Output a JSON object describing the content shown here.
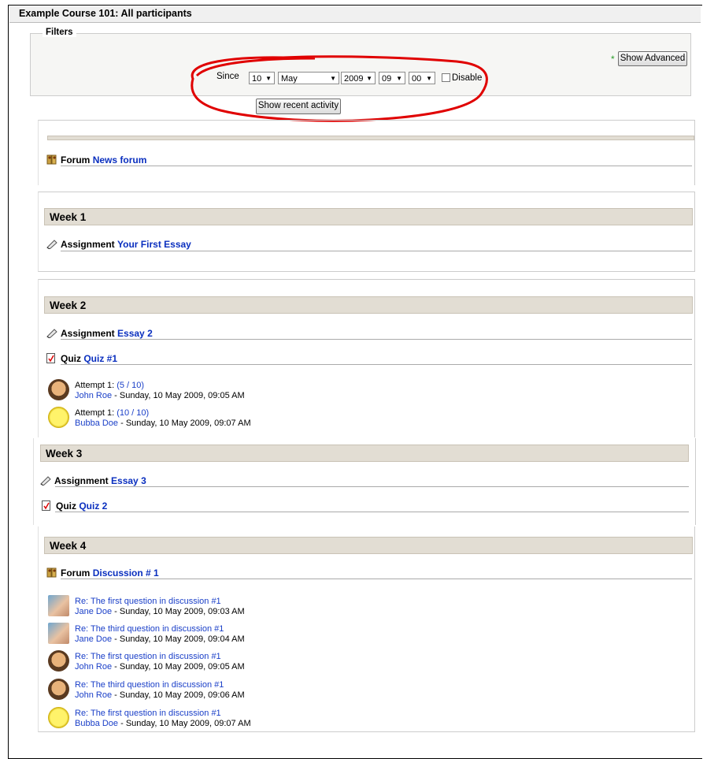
{
  "course": {
    "title": "Example Course 101: All participants"
  },
  "filters": {
    "legend": "Filters",
    "since_label": "Since",
    "day": "10",
    "month": "May",
    "year": "2009",
    "hour": "09",
    "minute": "00",
    "disable_label": "Disable",
    "required_mark": "*",
    "show_advanced": "Show Advanced",
    "show_recent": "Show recent activity"
  },
  "general": {
    "kind": "Forum",
    "name": "News forum"
  },
  "week1": {
    "title": "Week 1",
    "items": [
      {
        "kind": "Assignment",
        "name": "Your First Essay"
      }
    ]
  },
  "week2": {
    "title": "Week 2",
    "items": [
      {
        "kind": "Assignment",
        "name": "Essay 2"
      },
      {
        "kind": "Quiz",
        "name": "Quiz #1"
      }
    ],
    "attempts": [
      {
        "label": "Attempt 1:",
        "score": "(5 / 10)",
        "user": "John Roe",
        "when": " - Sunday, 10 May 2009, 09:05 AM"
      },
      {
        "label": "Attempt 1:",
        "score": "(10 / 10)",
        "user": "Bubba Doe",
        "when": " - Sunday, 10 May 2009, 09:07 AM"
      }
    ]
  },
  "week3": {
    "title": "Week 3",
    "items": [
      {
        "kind": "Assignment",
        "name": "Essay 3"
      },
      {
        "kind": "Quiz",
        "name": "Quiz 2"
      }
    ]
  },
  "week4": {
    "title": "Week 4",
    "items": [
      {
        "kind": "Forum",
        "name": "Discussion # 1"
      }
    ],
    "posts": [
      {
        "subject": "Re: The first question in discussion #1",
        "user": "Jane Doe",
        "when": " - Sunday, 10 May 2009, 09:03 AM",
        "avatar": "baby"
      },
      {
        "subject": "Re: The third question in discussion #1",
        "user": "Jane Doe",
        "when": " - Sunday, 10 May 2009, 09:04 AM",
        "avatar": "baby"
      },
      {
        "subject": "Re: The first question in discussion #1",
        "user": "John Roe",
        "when": " - Sunday, 10 May 2009, 09:05 AM",
        "avatar": "face"
      },
      {
        "subject": "Re: The third question in discussion #1",
        "user": "John Roe",
        "when": " - Sunday, 10 May 2009, 09:06 AM",
        "avatar": "face"
      },
      {
        "subject": "Re: The first question in discussion #1",
        "user": "Bubba Doe",
        "when": " - Sunday, 10 May 2009, 09:07 AM",
        "avatar": "smiley"
      }
    ]
  },
  "colors": {
    "link": "#0a2fbf",
    "week_bg": "#e2ddd3",
    "annotation": "#e00000"
  }
}
